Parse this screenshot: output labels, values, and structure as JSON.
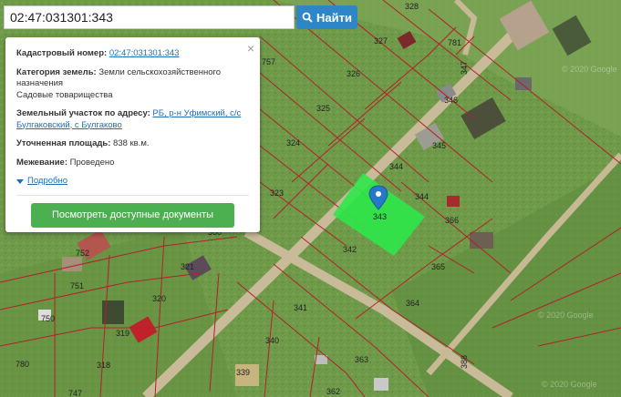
{
  "search": {
    "value": "02:47:031301:343",
    "button_label": "Найти"
  },
  "popup": {
    "cadastral_label": "Кадастровый номер:",
    "cadastral_value": "02:47:031301:343",
    "category_label": "Категория земель:",
    "category_value": "Земли сельскохозяйственного назначения",
    "category_sub": "Садовые товарищества",
    "address_label": "Земельный участок по адресу:",
    "address_value": "РБ, р-н Уфимский, с/с Булгаковский, с Булгаково",
    "area_label": "Уточненная площадь:",
    "area_value": "838 кв.м.",
    "survey_label": "Межевание:",
    "survey_value": "Проведено",
    "more_label": "Подробно",
    "docs_button": "Посмотреть доступные документы",
    "close_glyph": "×"
  },
  "map": {
    "parcels": [
      "328",
      "327",
      "781",
      "757",
      "326",
      "347",
      "346",
      "325",
      "345",
      "324",
      "344",
      "323",
      "344",
      "366",
      "342",
      "321",
      "365",
      "752",
      "751",
      "320",
      "364",
      "341",
      "750",
      "319",
      "340",
      "363",
      "780",
      "318",
      "339",
      "388",
      "362",
      "747",
      "360",
      "343"
    ],
    "watermarks": [
      "© 2020 Google",
      "© 2020 Google",
      "© 2020 Google"
    ],
    "highlight_color": "#2ee84a",
    "line_color": "#b3202a"
  }
}
